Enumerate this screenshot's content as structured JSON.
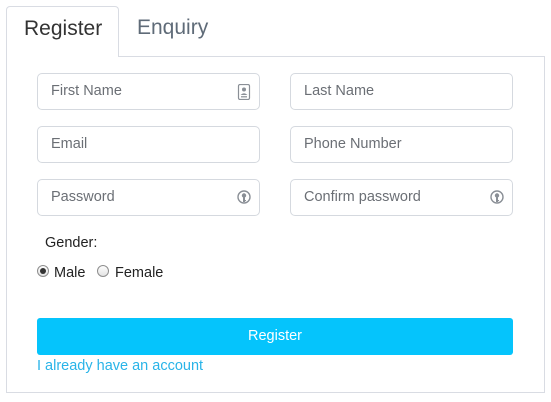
{
  "tabs": [
    {
      "label": "Register",
      "active": true
    },
    {
      "label": "Enquiry",
      "active": false
    }
  ],
  "form": {
    "first_name": {
      "placeholder": "First Name",
      "icon": "contact-card-icon"
    },
    "last_name": {
      "placeholder": "Last Name"
    },
    "email": {
      "placeholder": "Email"
    },
    "phone": {
      "placeholder": "Phone Number"
    },
    "password": {
      "placeholder": "Password",
      "icon": "password-key-icon"
    },
    "confirm_password": {
      "placeholder": "Confirm password",
      "icon": "password-key-icon"
    },
    "gender_label": "Gender:",
    "gender_options": [
      {
        "label": "Male",
        "selected": true
      },
      {
        "label": "Female",
        "selected": false
      }
    ],
    "submit_label": "Register",
    "login_link": "I already have an account"
  },
  "colors": {
    "accent": "#05c4fc",
    "link": "#29b4e8",
    "border": "#d5d9df"
  }
}
